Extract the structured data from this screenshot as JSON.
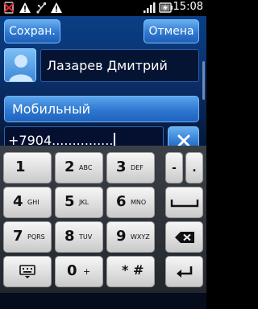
{
  "status_bar": {
    "time": "15:08",
    "icons": [
      "no-sim-icon",
      "warning-icon",
      "usb-icon",
      "warning-icon",
      "signal-icon",
      "battery-charging-icon"
    ]
  },
  "header": {
    "save_label": "Сохран.",
    "cancel_label": "Отмена"
  },
  "contact": {
    "name": "Лазарев Дмитрий"
  },
  "phone": {
    "type_label": "Мобильный",
    "value": "+7904..............."
  },
  "keypad": {
    "rows": [
      [
        {
          "num": "1",
          "letters": ""
        },
        {
          "num": "2",
          "letters": "ABC"
        },
        {
          "num": "3",
          "letters": "DEF"
        },
        {
          "num": "-",
          "letters": ""
        },
        {
          "num": ".",
          "letters": ""
        }
      ],
      [
        {
          "num": "4",
          "letters": "GHI"
        },
        {
          "num": "5",
          "letters": "JKL"
        },
        {
          "num": "6",
          "letters": "MNO"
        }
      ],
      [
        {
          "num": "7",
          "letters": "PQRS"
        },
        {
          "num": "8",
          "letters": "TUV"
        },
        {
          "num": "9",
          "letters": "WXYZ"
        }
      ],
      [
        {
          "num": "0",
          "letters": "+"
        },
        {
          "num": "* #",
          "letters": "("
        }
      ]
    ]
  }
}
